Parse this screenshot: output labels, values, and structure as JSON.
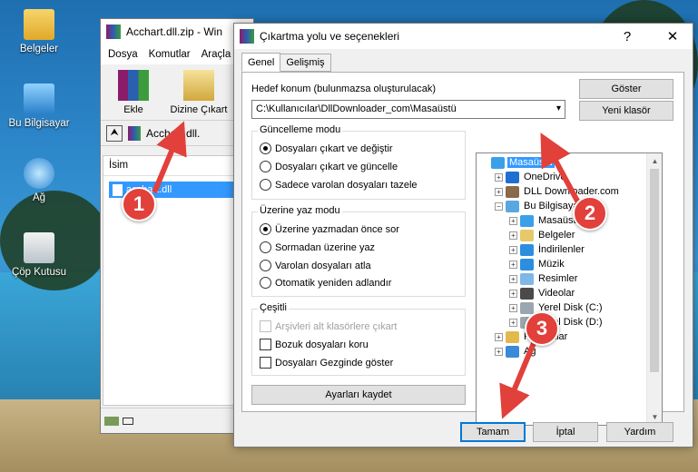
{
  "desktop": {
    "icons": [
      {
        "label": "Belgeler",
        "icon": "documents-folder-icon"
      },
      {
        "label": "Bu Bilgisayar",
        "icon": "computer-icon"
      },
      {
        "label": "Ağ",
        "icon": "network-icon"
      },
      {
        "label": "Çöp Kutusu",
        "icon": "recycle-bin-icon"
      }
    ]
  },
  "winrar": {
    "title": "Acchart.dll.zip - Win",
    "menu": [
      "Dosya",
      "Komutlar",
      "Araçla"
    ],
    "toolbar": {
      "add": "Ekle",
      "extract_to": "Dizine Çıkart"
    },
    "path": "Acchart.dll.",
    "column_name": "İsim",
    "file_row": "acchart.dll"
  },
  "dialog": {
    "title": "Çıkartma yolu ve seçenekleri",
    "tabs": [
      "Genel",
      "Gelişmiş"
    ],
    "destination_label": "Hedef konum (bulunmazsa oluşturulacak)",
    "destination_value": "C:\\Kullanıcılar\\DllDownloader_com\\Masaüstü",
    "show_button": "Göster",
    "new_folder_button": "Yeni klasör",
    "update_mode": {
      "title": "Güncelleme modu",
      "options": [
        "Dosyaları çıkart ve değiştir",
        "Dosyaları çıkart ve güncelle",
        "Sadece varolan dosyaları tazele"
      ],
      "selected": 0
    },
    "overwrite_mode": {
      "title": "Üzerine yaz modu",
      "options": [
        "Üzerine yazmadan önce sor",
        "Sormadan üzerine yaz",
        "Varolan dosyaları atla",
        "Otomatik yeniden adlandır"
      ],
      "selected": 0
    },
    "misc": {
      "title": "Çeşitli",
      "options": [
        "Arşivleri alt klasörlere çıkart",
        "Bozuk dosyaları koru",
        "Dosyaları Gezginde göster"
      ]
    },
    "save_settings": "Ayarları kaydet",
    "tree": [
      {
        "label": "Masaüstü",
        "level": 0,
        "selected": true,
        "expander": "",
        "icon": "desktop-icon"
      },
      {
        "label": "OneDrive",
        "level": 1,
        "expander": "+",
        "icon": "onedrive-icon"
      },
      {
        "label": "DLL Downloader.com",
        "level": 1,
        "expander": "+",
        "icon": "user-icon"
      },
      {
        "label": "Bu Bilgisayar",
        "level": 1,
        "expander": "−",
        "icon": "computer-icon"
      },
      {
        "label": "Masaüstü",
        "level": 2,
        "expander": "+",
        "icon": "desktop-icon"
      },
      {
        "label": "Belgeler",
        "level": 2,
        "expander": "+",
        "icon": "documents-icon"
      },
      {
        "label": "İndirilenler",
        "level": 2,
        "expander": "+",
        "icon": "download-icon"
      },
      {
        "label": "Müzik",
        "level": 2,
        "expander": "+",
        "icon": "music-icon"
      },
      {
        "label": "Resimler",
        "level": 2,
        "expander": "+",
        "icon": "pictures-icon"
      },
      {
        "label": "Videolar",
        "level": 2,
        "expander": "+",
        "icon": "videos-icon"
      },
      {
        "label": "Yerel Disk (C:)",
        "level": 2,
        "expander": "+",
        "icon": "drive-icon"
      },
      {
        "label": "Yerel Disk (D:)",
        "level": 2,
        "expander": "+",
        "icon": "drive-icon"
      },
      {
        "label": "Kitaplıklar",
        "level": 1,
        "expander": "+",
        "icon": "libraries-icon"
      },
      {
        "label": "Ağ",
        "level": 1,
        "expander": "+",
        "icon": "network-icon"
      }
    ],
    "ok_button": "Tamam",
    "cancel_button": "İptal",
    "help_button": "Yardım"
  },
  "annotations": [
    "1",
    "2",
    "3"
  ],
  "colors": {
    "selection": "#3399ff",
    "marker": "#e2403b",
    "dialog_bg": "#f0f0f0"
  }
}
